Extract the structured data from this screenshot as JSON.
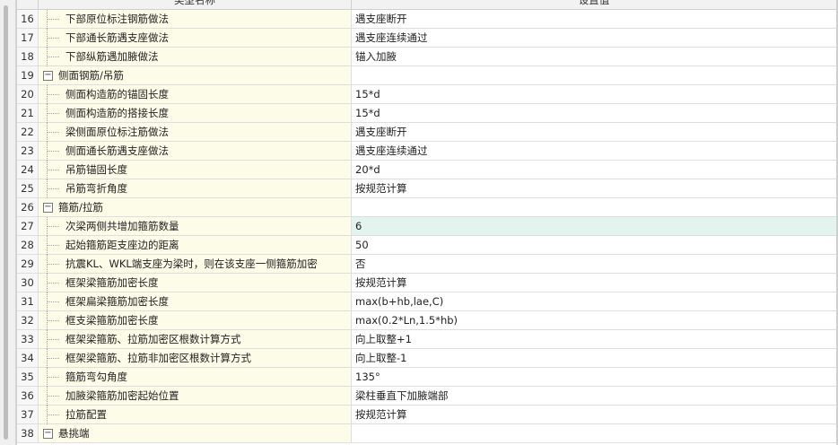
{
  "header": {
    "col_name": "类型名称",
    "col_value": "设置值"
  },
  "rows": [
    {
      "num": "16",
      "name": "下部原位标注钢筋做法",
      "value": "遇支座断开",
      "kind": "child"
    },
    {
      "num": "17",
      "name": "下部通长筋遇支座做法",
      "value": "遇支座连续通过",
      "kind": "child"
    },
    {
      "num": "18",
      "name": "下部纵筋遇加腋做法",
      "value": "锚入加腋",
      "kind": "child"
    },
    {
      "num": "19",
      "name": "侧面钢筋/吊筋",
      "value": "",
      "kind": "group",
      "toggle": "−"
    },
    {
      "num": "20",
      "name": "侧面构造筋的锚固长度",
      "value": "15*d",
      "kind": "child"
    },
    {
      "num": "21",
      "name": "侧面构造筋的搭接长度",
      "value": "15*d",
      "kind": "child"
    },
    {
      "num": "22",
      "name": "梁侧面原位标注筋做法",
      "value": "遇支座断开",
      "kind": "child"
    },
    {
      "num": "23",
      "name": "侧面通长筋遇支座做法",
      "value": "遇支座连续通过",
      "kind": "child"
    },
    {
      "num": "24",
      "name": "吊筋锚固长度",
      "value": "20*d",
      "kind": "child"
    },
    {
      "num": "25",
      "name": "吊筋弯折角度",
      "value": "按规范计算",
      "kind": "child"
    },
    {
      "num": "26",
      "name": "箍筋/拉筋",
      "value": "",
      "kind": "group",
      "toggle": "−"
    },
    {
      "num": "27",
      "name": "次梁两侧共增加箍筋数量",
      "value": "6",
      "kind": "child",
      "selected": true
    },
    {
      "num": "28",
      "name": "起始箍筋距支座边的距离",
      "value": "50",
      "kind": "child"
    },
    {
      "num": "29",
      "name": "抗震KL、WKL端支座为梁时，则在该支座一侧箍筋加密",
      "value": "否",
      "kind": "child"
    },
    {
      "num": "30",
      "name": "框架梁箍筋加密长度",
      "value": "按规范计算",
      "kind": "child"
    },
    {
      "num": "31",
      "name": "框架扁梁箍筋加密长度",
      "value": "max(b+hb,lae,C)",
      "kind": "child"
    },
    {
      "num": "32",
      "name": "框支梁箍筋加密长度",
      "value": "max(0.2*Ln,1.5*hb)",
      "kind": "child"
    },
    {
      "num": "33",
      "name": "框架梁箍筋、拉筋加密区根数计算方式",
      "value": "向上取整+1",
      "kind": "child"
    },
    {
      "num": "34",
      "name": "框架梁箍筋、拉筋非加密区根数计算方式",
      "value": "向上取整-1",
      "kind": "child"
    },
    {
      "num": "35",
      "name": "箍筋弯勾角度",
      "value": "135°",
      "kind": "child"
    },
    {
      "num": "36",
      "name": "加腋梁箍筋加密起始位置",
      "value": "梁柱垂直下加腋端部",
      "kind": "child"
    },
    {
      "num": "37",
      "name": "拉筋配置",
      "value": "按规范计算",
      "kind": "child"
    },
    {
      "num": "38",
      "name": "悬挑端",
      "value": "",
      "kind": "group",
      "toggle": "−"
    }
  ]
}
